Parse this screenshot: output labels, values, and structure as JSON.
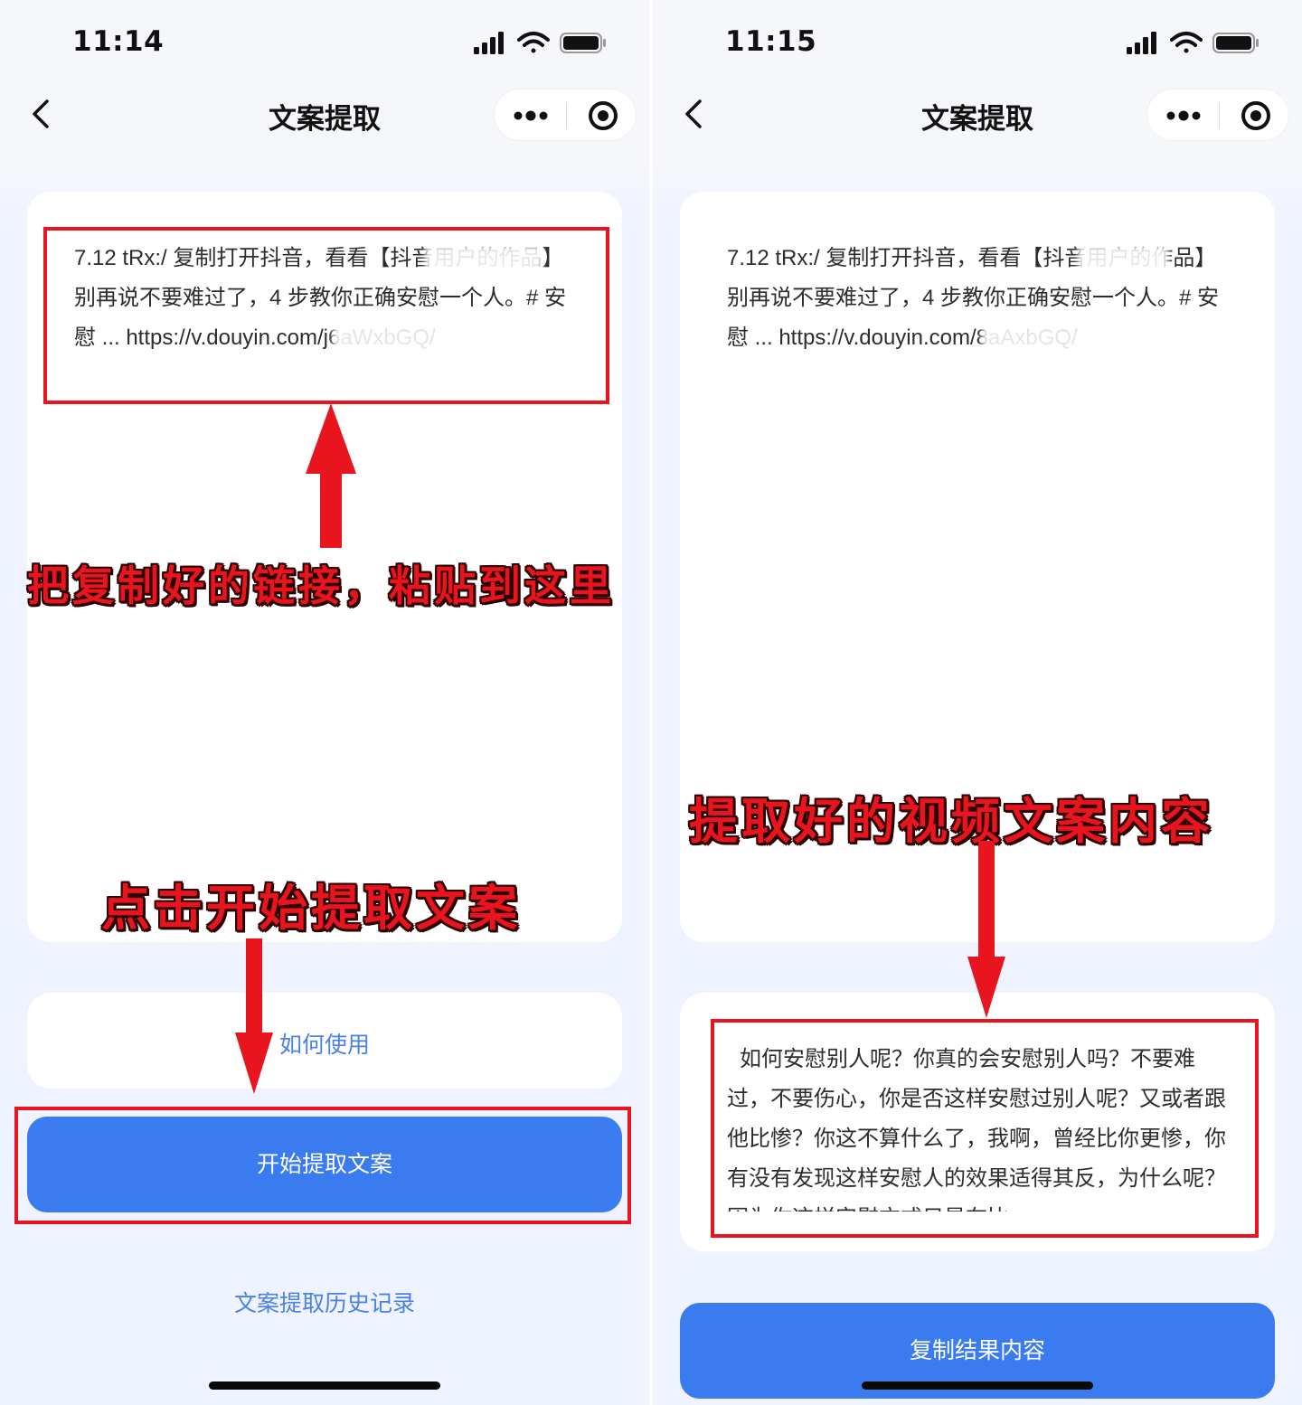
{
  "left": {
    "status_time": "11:14",
    "nav_title": "文案提取",
    "input_text": "7.12 tRx:/ 复制打开抖音，看看【抖音用户的作品】别再说不要难过了，4 步教你正确安慰一个人。# 安慰 ... https://v.douyin.com/j6aWxbGQ/",
    "annotation_paste": "把复制好的链接，粘贴到这里",
    "annotation_start": "点击开始提取文案",
    "howto_label": "如何使用",
    "start_button": "开始提取文案",
    "history_link": "文案提取历史记录"
  },
  "right": {
    "status_time": "11:15",
    "nav_title": "文案提取",
    "input_text": "7.12 tRx:/ 复制打开抖音，看看【抖音用户的作品】别再说不要难过了，4 步教你正确安慰一个人。# 安慰 ... https://v.douyin.com/8aAxbGQ/",
    "annotation_result": "提取好的视频文案内容",
    "result_text": "如何安慰别人呢？你真的会安慰别人吗？不要难过，不要伤心，你是否这样安慰过别人呢？又或者跟他比惨？你这不算什么了，我啊，曾经比你更惨，你有没有发现这样安慰人的效果适得其反，为什么呢？因为你这样安慰方式只是在比",
    "copy_button": "复制结果内容"
  },
  "colors": {
    "primary": "#3b7bf0",
    "link": "#4a80e8",
    "annotation_red": "#e8141e"
  },
  "icons": [
    "back-chevron-icon",
    "more-dots-icon",
    "target-circle-icon",
    "cellular-signal-icon",
    "wifi-icon",
    "battery-icon"
  ]
}
